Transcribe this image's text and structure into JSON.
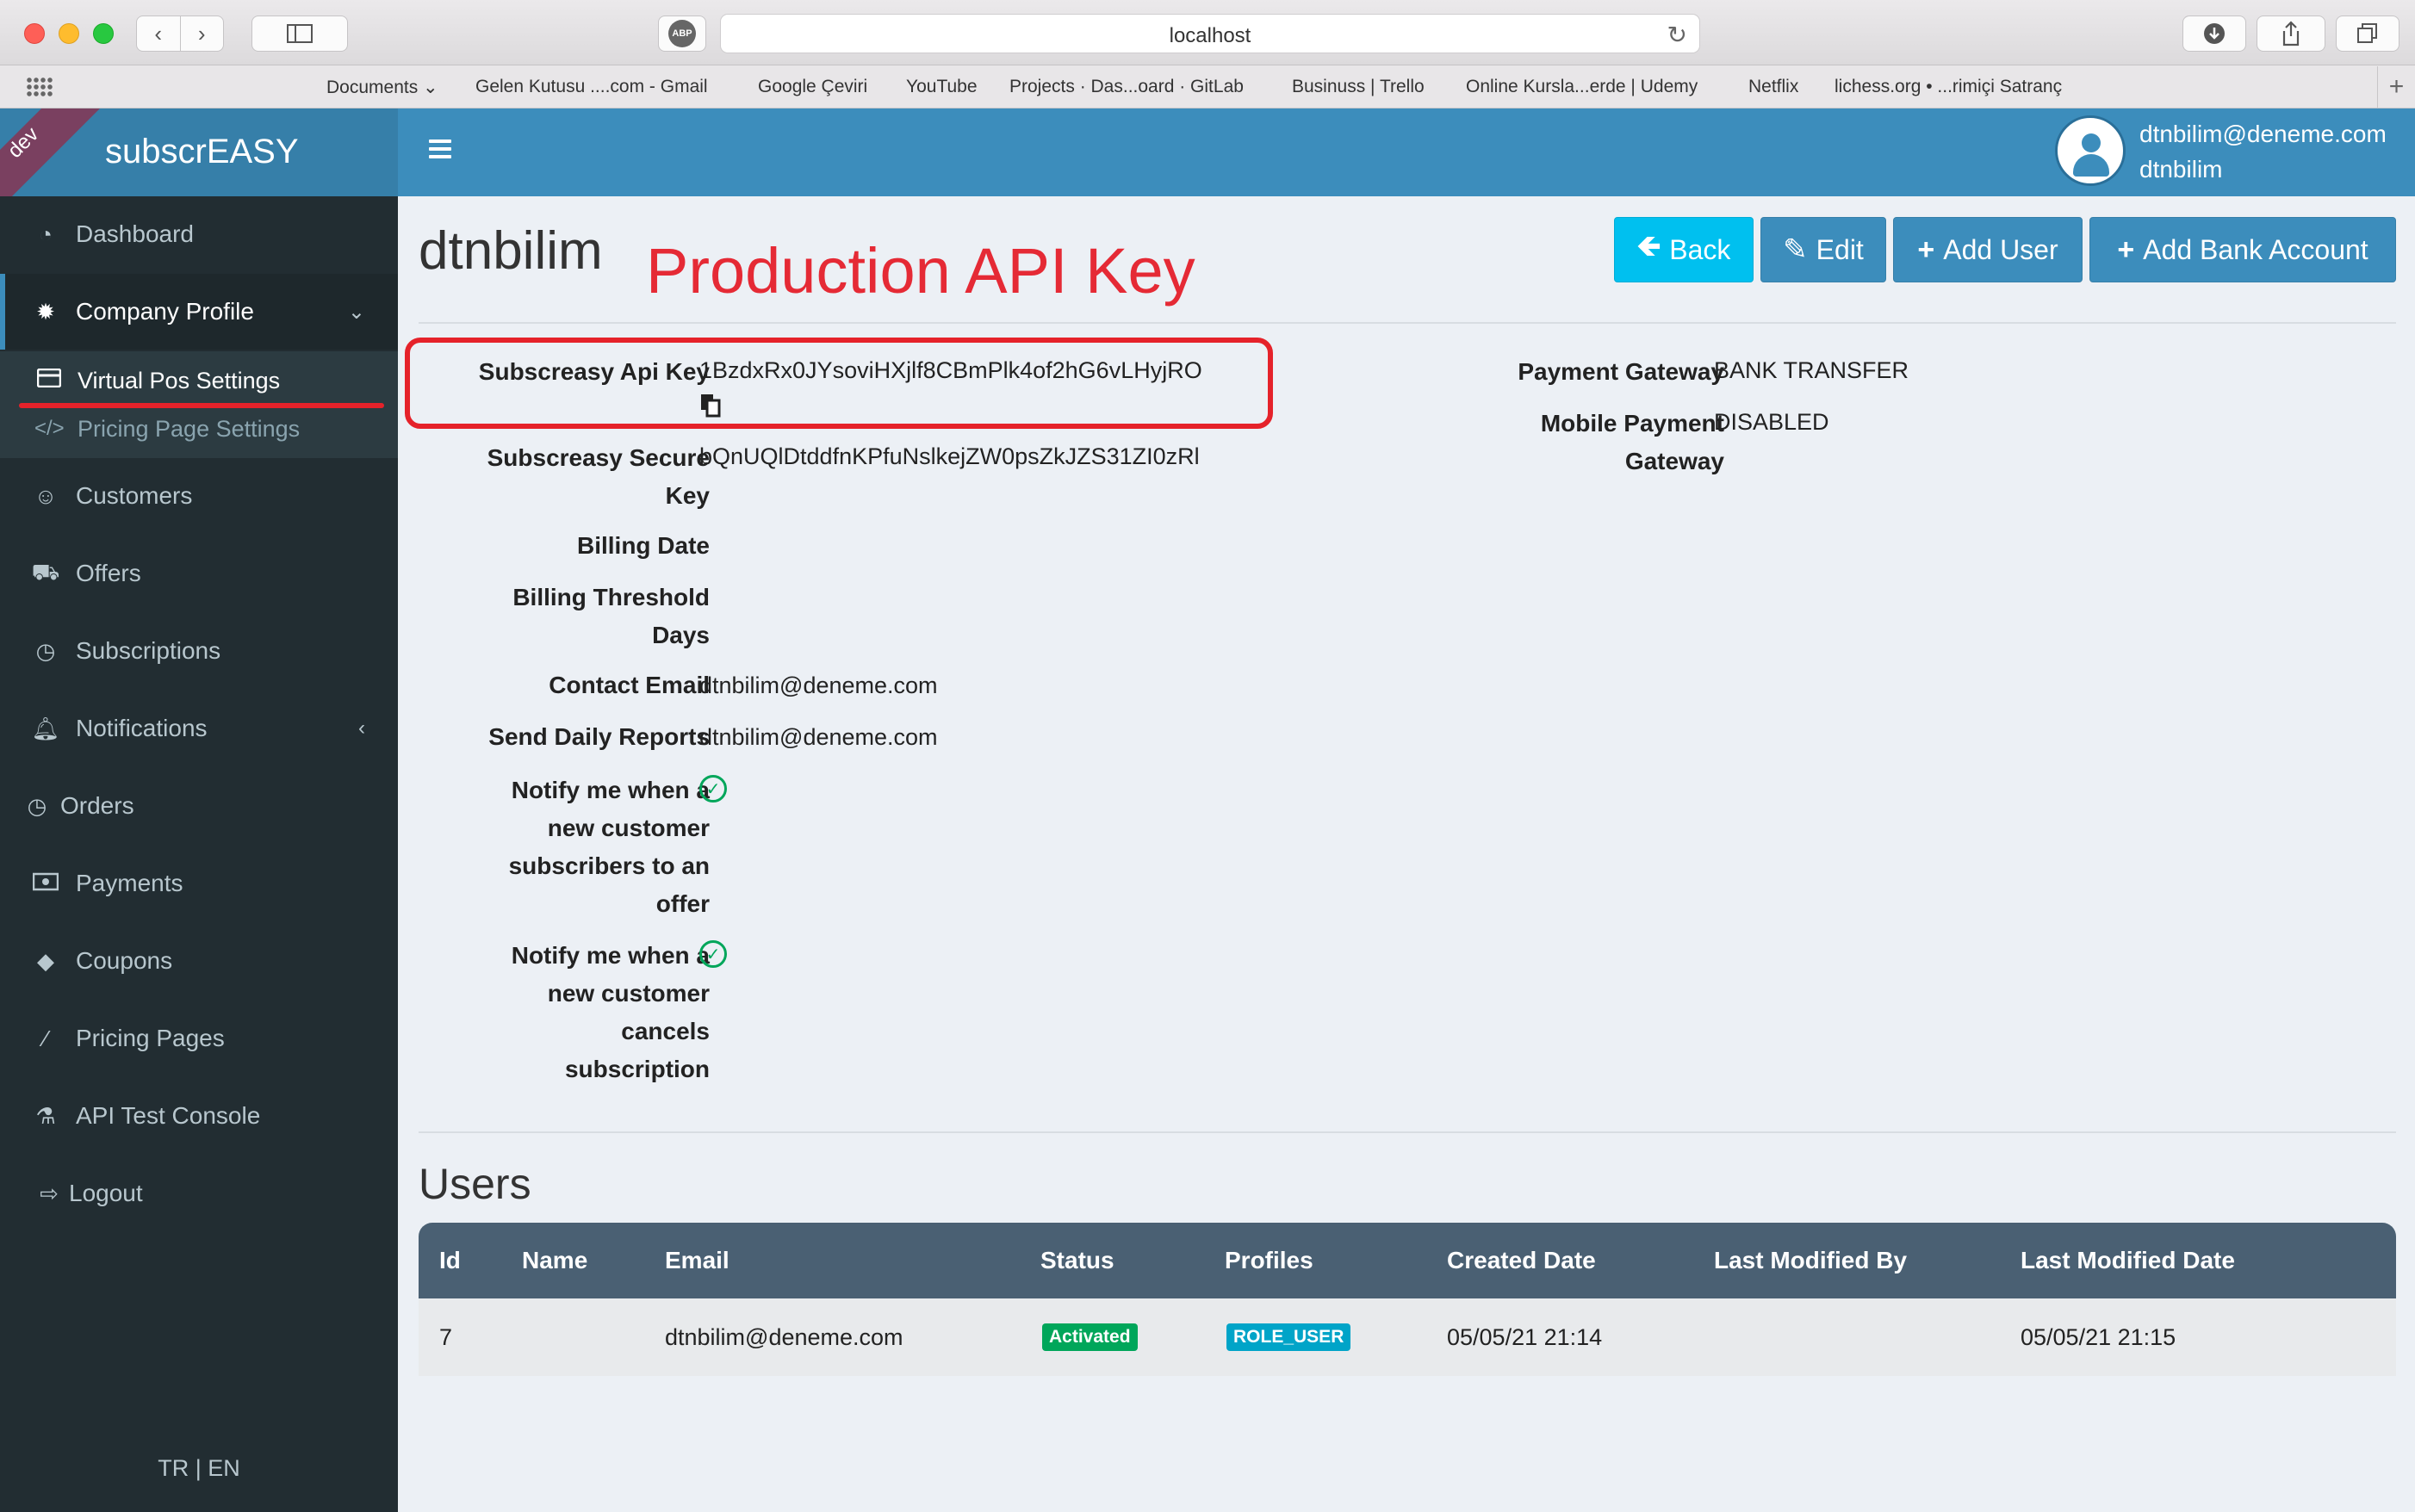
{
  "browser": {
    "url": "localhost",
    "abp": "ABP",
    "bookmarks": [
      "Documents",
      "Gelen Kutusu ....com - Gmail",
      "Google Çeviri",
      "YouTube",
      "Projects · Das...oard · GitLab",
      "Businuss | Trello",
      "Online Kursla...erde | Udemy",
      "Netflix",
      "lichess.org • ...rimiçi Satranç"
    ]
  },
  "app": {
    "brand": "subscrEASY",
    "env_ribbon": "dev",
    "user_email": "dtnbilim@deneme.com",
    "user_name": "dtnbilim"
  },
  "sidebar": {
    "items": [
      {
        "label": "Dashboard",
        "icon": "dashboard-icon"
      },
      {
        "label": "Company Profile",
        "icon": "gear-icon"
      },
      {
        "label": "Customers",
        "icon": "smile-icon"
      },
      {
        "label": "Offers",
        "icon": "cart-icon"
      },
      {
        "label": "Subscriptions",
        "icon": "clock-icon"
      },
      {
        "label": "Notifications",
        "icon": "bell-icon"
      },
      {
        "label": "Orders",
        "icon": "clock-icon"
      },
      {
        "label": "Payments",
        "icon": "money-icon"
      },
      {
        "label": "Coupons",
        "icon": "tag-icon"
      },
      {
        "label": "Pricing Pages",
        "icon": "wand-icon"
      },
      {
        "label": "API Test Console",
        "icon": "flask-icon"
      },
      {
        "label": "Logout",
        "icon": "sign-out-icon"
      }
    ],
    "submenu": [
      {
        "label": "Virtual Pos Settings",
        "icon": "credit-card-icon"
      },
      {
        "label": "Pricing Page Settings",
        "icon": "code-icon"
      }
    ],
    "lang": "TR | EN"
  },
  "page": {
    "title": "dtnbilim",
    "annotation": "Production API Key",
    "buttons": {
      "back": "Back",
      "edit": "Edit",
      "add_user": "Add User",
      "add_bank": "Add Bank Account"
    }
  },
  "details": {
    "api_key_label": "Subscreasy Api Key",
    "api_key_value": "1BzdxRx0JYsoviHXjlf8CBmPlk4of2hG6vLHyjRO",
    "secure_key_label_1": "Subscreasy Secure",
    "secure_key_label_2": "Key",
    "secure_key_value": "bQnUQlDtddfnKPfuNslkejZW0psZkJZS31ZI0zRl",
    "billing_date_label": "Billing Date",
    "billing_threshold_label_1": "Billing Threshold",
    "billing_threshold_label_2": "Days",
    "contact_email_label": "Contact Email",
    "contact_email_value": "dtnbilim@deneme.com",
    "daily_reports_label": "Send Daily Reports",
    "daily_reports_value": "dtnbilim@deneme.com",
    "notify_sub_label": [
      "Notify me when a",
      "new customer",
      "subscribers to an",
      "offer"
    ],
    "notify_cancel_label": [
      "Notify me when a",
      "new customer",
      "cancels",
      "subscription"
    ],
    "payment_gateway_label": "Payment Gateway",
    "payment_gateway_value": "BANK TRANSFER",
    "mobile_gateway_label_1": "Mobile Payment",
    "mobile_gateway_label_2": "Gateway",
    "mobile_gateway_value": "DISABLED"
  },
  "users": {
    "title": "Users",
    "headers": [
      "Id",
      "Name",
      "Email",
      "Status",
      "Profiles",
      "Created Date",
      "Last Modified By",
      "Last Modified Date"
    ],
    "rows": [
      {
        "id": "7",
        "name": "",
        "email": "dtnbilim@deneme.com",
        "status": "Activated",
        "profile": "ROLE_USER",
        "created": "05/05/21 21:14",
        "modified_by": "",
        "modified": "05/05/21 21:15"
      }
    ]
  },
  "colors": {
    "primary": "#3c8dbc",
    "info": "#00c0ef",
    "success": "#00a65a",
    "annotation": "#e5222a",
    "sidebar": "#222d32"
  }
}
